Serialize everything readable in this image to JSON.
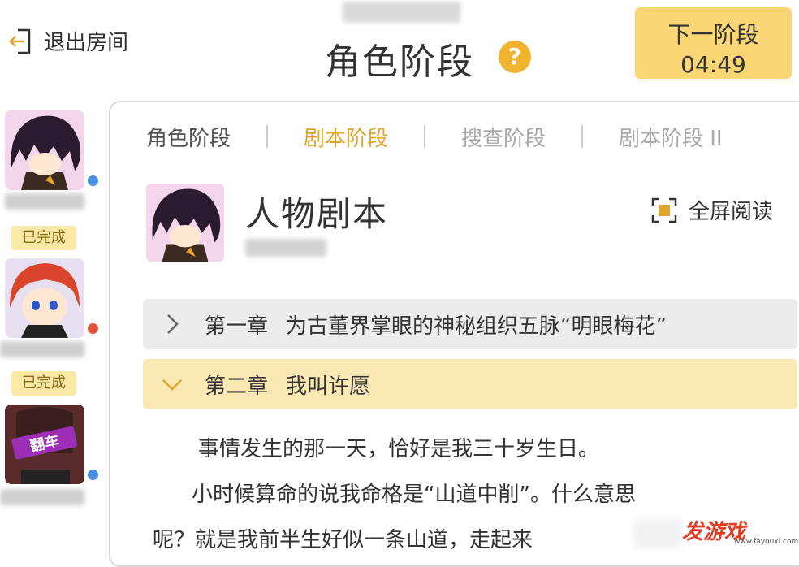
{
  "header": {
    "exit_label": "退出房间",
    "stage_title": "角色阶段",
    "help_symbol": "?",
    "next_stage_label": "下一阶段",
    "next_stage_timer": "04:49"
  },
  "sidebar": {
    "players": [
      {
        "status_dot_color": "#4a90e2",
        "badge": "已完成"
      },
      {
        "status_dot_color": "#e2553a",
        "badge": "已完成"
      },
      {
        "status_dot_color": "#4a90e2",
        "avatar_text": "翻车"
      }
    ]
  },
  "tabs": [
    {
      "label": "角色阶段",
      "state": "normal"
    },
    {
      "label": "剧本阶段",
      "state": "active"
    },
    {
      "label": "搜查阶段",
      "state": "disabled"
    },
    {
      "label": "剧本阶段 II",
      "state": "disabled"
    }
  ],
  "script": {
    "heading": "人物剧本",
    "fullscreen_label": "全屏阅读",
    "chapters": [
      {
        "number": "第一章",
        "title": "为古董界掌眼的神秘组织五脉“明眼梅花”",
        "expanded": false
      },
      {
        "number": "第二章",
        "title": "我叫许愿",
        "expanded": true
      }
    ],
    "paragraph_lines": [
      "事情发生的那一天，恰好是我三十岁生日。",
      "小时候算命的说我命格是“山道中削”。什么意思",
      "呢？就是我前半生好似一条山道，走起来"
    ]
  },
  "watermark": {
    "logo": "发游戏",
    "url": "www.fayouxi.com"
  },
  "colors": {
    "accent": "#e0a52a",
    "next_button_bg": "#fad774",
    "expanded_chapter_bg": "#fbe9b4",
    "collapsed_chapter_bg": "#ececec",
    "badge_bg": "#fbe9a8"
  }
}
